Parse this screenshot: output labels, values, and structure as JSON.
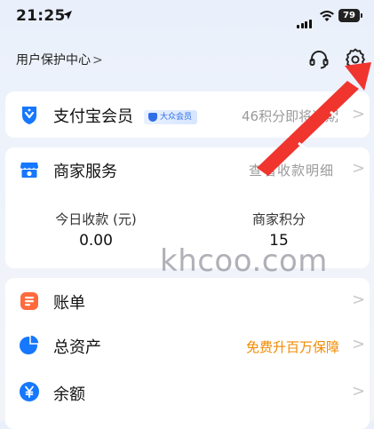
{
  "status_bar": {
    "time": "21:25",
    "battery": "79"
  },
  "header": {
    "user_protection": "用户保护中心",
    "chevron": ">"
  },
  "membership": {
    "title": "支付宝会员",
    "badge": "大众会员",
    "right_text": "46积分即将过期"
  },
  "merchant": {
    "title": "商家服务",
    "right_text": "查看收款明细",
    "stats": [
      {
        "label": "今日收款 (元)",
        "value": "0.00"
      },
      {
        "label": "商家积分",
        "value": "15"
      }
    ]
  },
  "menu": [
    {
      "label": "账单",
      "right_text": ""
    },
    {
      "label": "总资产",
      "right_text": "免费升百万保障"
    },
    {
      "label": "余额",
      "right_text": ""
    }
  ],
  "chevron": ">",
  "watermark": "khcoo.com",
  "colors": {
    "brand_blue": "#1677ff",
    "arrow_red": "#f0352f",
    "orange": "#f08a00"
  }
}
